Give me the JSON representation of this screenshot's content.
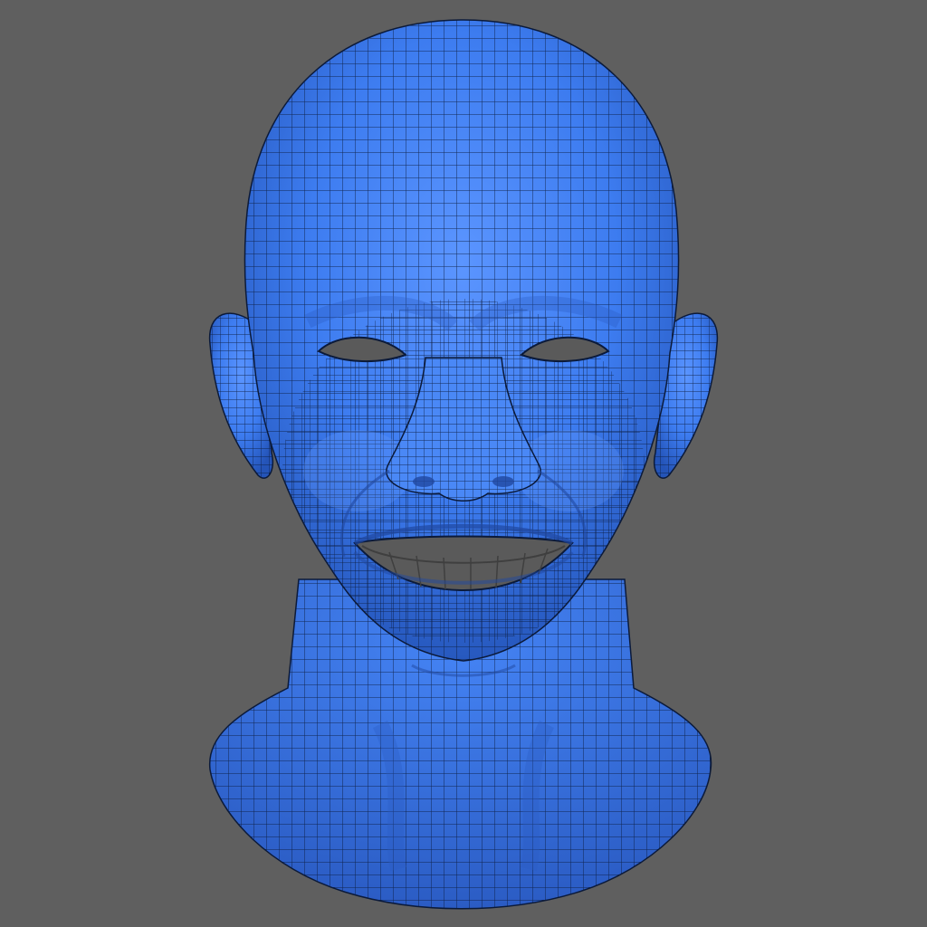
{
  "viewport": {
    "background_color": "#5f5f5f"
  },
  "model": {
    "subject": "head-and-neck",
    "expression": "smiling",
    "render_mode": "wireframe-over-shaded",
    "surface_color": "#3d7cf0",
    "shadow_color": "#2454b8",
    "highlight_color": "#6aa0ff",
    "wire_color": "#0b1a3a",
    "cavity_color": "#5a5a5a"
  }
}
